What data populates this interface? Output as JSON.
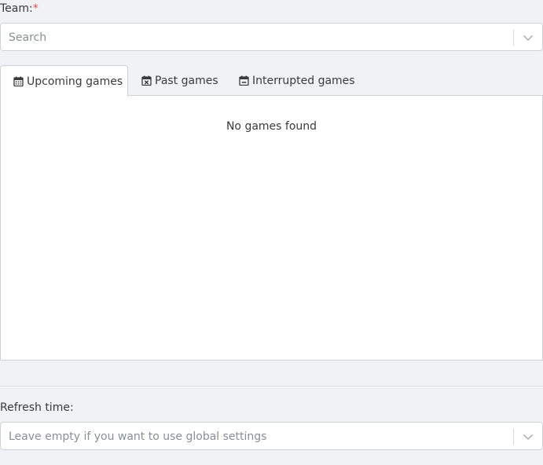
{
  "team": {
    "label": "Team:",
    "required_marker": "*",
    "placeholder": "Search"
  },
  "tabs": [
    {
      "label": "Upcoming games",
      "icon": "calendar-icon",
      "active": true
    },
    {
      "label": "Past games",
      "icon": "calendar-x-icon",
      "active": false
    },
    {
      "label": "Interrupted games",
      "icon": "calendar-minus-icon",
      "active": false
    }
  ],
  "panel": {
    "empty_message": "No games found"
  },
  "refresh": {
    "label": "Refresh time:",
    "placeholder": "Leave empty if you want to use global settings"
  },
  "colors": {
    "background": "#f1f2f4",
    "required": "#d9534f",
    "border": "#cfd3d7"
  }
}
